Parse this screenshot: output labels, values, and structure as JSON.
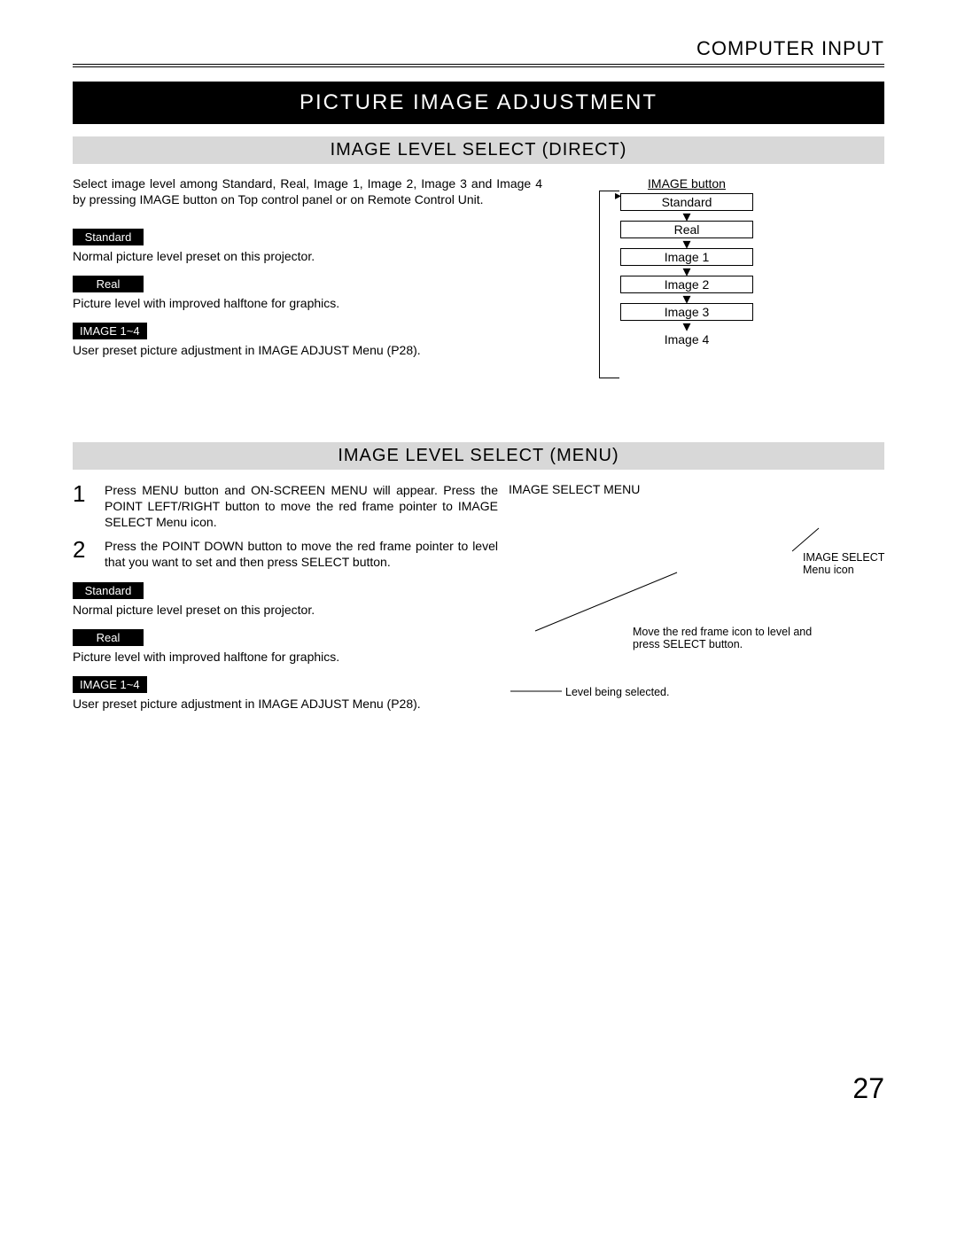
{
  "chapter_title": "COMPUTER INPUT",
  "page_title": "PICTURE IMAGE ADJUSTMENT",
  "page_number": "27",
  "direct": {
    "section_title": "IMAGE LEVEL SELECT (DIRECT)",
    "intro": "Select image level among Standard, Real, Image 1, Image 2, Image 3 and Image 4 by pressing IMAGE button on Top control panel or on Remote Control Unit.",
    "items": [
      {
        "tag": "Standard",
        "desc": "Normal picture level preset on this projector."
      },
      {
        "tag": "Real",
        "desc": "Picture level with improved halftone for graphics."
      },
      {
        "tag": "IMAGE 1~4",
        "desc": "User preset picture adjustment in IMAGE ADJUST Menu (P28)."
      }
    ],
    "flow": {
      "heading": "IMAGE button",
      "nodes": [
        "Standard",
        "Real",
        "Image 1",
        "Image 2",
        "Image 3",
        "Image 4"
      ]
    }
  },
  "menu": {
    "section_title": "IMAGE LEVEL SELECT (MENU)",
    "steps": [
      {
        "num": "1",
        "text": "Press MENU button and ON-SCREEN MENU will appear.  Press the POINT LEFT/RIGHT button to move the red frame pointer to IMAGE SELECT Menu icon."
      },
      {
        "num": "2",
        "text": "Press the POINT DOWN button to move the red frame pointer to level that you want to set and then press SELECT button."
      }
    ],
    "items": [
      {
        "tag": "Standard",
        "desc": "Normal picture level preset on this projector."
      },
      {
        "tag": "Real",
        "desc": "Picture level with improved halftone for graphics."
      },
      {
        "tag": "IMAGE 1~4",
        "desc": "User preset picture adjustment in IMAGE ADJUST Menu (P28)."
      }
    ],
    "diagram_title": "IMAGE SELECT MENU",
    "annotations": {
      "icon_label_1": "IMAGE SELECT",
      "icon_label_2": "Menu icon",
      "pointer_hint": "Move the red frame icon to level and press SELECT button.",
      "selected_hint": "Level being selected."
    }
  }
}
